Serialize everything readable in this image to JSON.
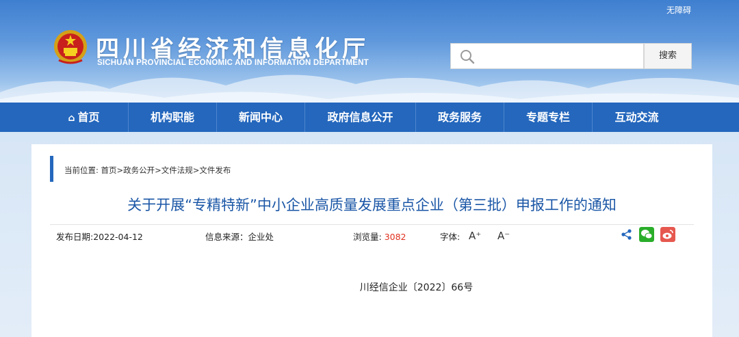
{
  "header": {
    "accessibility_label": "无障碍",
    "site_title": "四川省经济和信息化厅",
    "site_subtitle": "SICHUAN PROVINCIAL ECONOMIC AND INFORMATION DEPARTMENT",
    "search_placeholder": "",
    "search_button": "搜索"
  },
  "nav": {
    "items": [
      {
        "label": "首页",
        "icon": "home-icon"
      },
      {
        "label": "机构职能"
      },
      {
        "label": "新闻中心"
      },
      {
        "label": "政府信息公开"
      },
      {
        "label": "政务服务"
      },
      {
        "label": "专题专栏"
      },
      {
        "label": "互动交流"
      }
    ]
  },
  "article": {
    "breadcrumb": "当前位置: 首页>政务公开>文件法规>文件发布",
    "title": "关于开展“专精特新”中小企业高质量发展重点企业（第三批）申报工作的通知",
    "publish_date": "发布日期:2022-04-12",
    "source": "信息来源：企业处",
    "views_label": "浏览量:",
    "views_value": "3082",
    "font_label": "字体:",
    "font_increase": "A⁺",
    "font_decrease": "A⁻",
    "doc_number": "川经信企业〔2022〕66号"
  },
  "colors": {
    "nav_bg": "#2467bd",
    "title_blue": "#1a56a6",
    "views_red": "#e0301e",
    "wechat_green": "#2aae2a",
    "weibo_red": "#e6584f"
  }
}
